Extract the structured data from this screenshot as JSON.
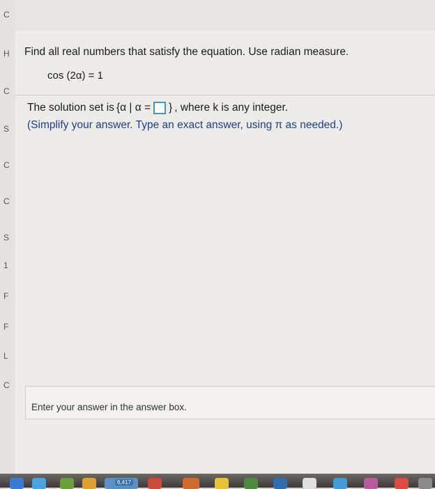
{
  "question": {
    "prompt": "Find all real numbers that satisfy the equation. Use radian measure.",
    "equation": "cos (2α) = 1"
  },
  "solution": {
    "prefix": "The solution set is",
    "set_open": "{α | α =",
    "set_close": "}",
    "suffix": ", where k is any integer.",
    "instruction": "(Simplify your answer. Type an exact answer, using π as needed.)",
    "answer_value": ""
  },
  "footer": {
    "hint": "Enter your answer in the answer box."
  },
  "dock": {
    "badge": "6,417"
  },
  "left_strip": {
    "fragments": [
      "C",
      "H",
      "C",
      "S",
      "C",
      "C",
      "S",
      "1",
      "F",
      "F",
      "L",
      "C"
    ]
  },
  "colors": {
    "instruction_text": "#1b3f9a",
    "answer_box_border": "#4a90c8"
  }
}
